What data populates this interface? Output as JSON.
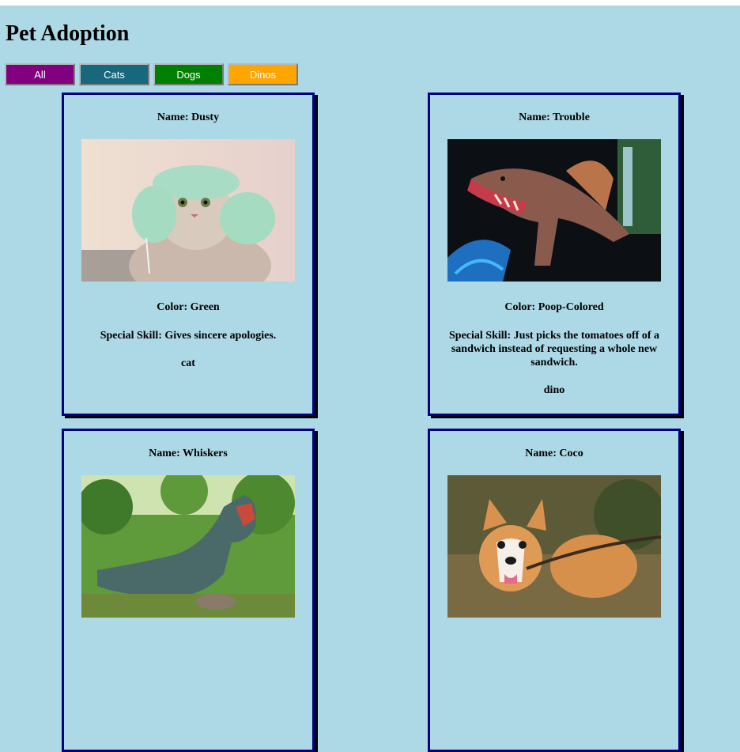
{
  "page": {
    "title": "Pet Adoption",
    "background": "#add8e6"
  },
  "filters": [
    {
      "label": "All",
      "color": "#800080"
    },
    {
      "label": "Cats",
      "color": "#17677d"
    },
    {
      "label": "Dogs",
      "color": "#008000"
    },
    {
      "label": "Dinos",
      "color": "#ffa500"
    }
  ],
  "pets": [
    {
      "name": "Name: Dusty",
      "photo": "cat-photo",
      "color": "Color: Green",
      "skill": "Special Skill: Gives sincere apologies.",
      "type": "cat"
    },
    {
      "name": "Name: Trouble",
      "photo": "dino-photo",
      "color": "Color: Poop-Colored",
      "skill": "Special Skill: Just picks the tomatoes off of a sandwich instead of requesting a whole new sandwich.",
      "type": "dino"
    },
    {
      "name": "Name: Whiskers",
      "photo": "dino-photo"
    },
    {
      "name": "Name: Coco",
      "photo": "dog-photo"
    }
  ]
}
